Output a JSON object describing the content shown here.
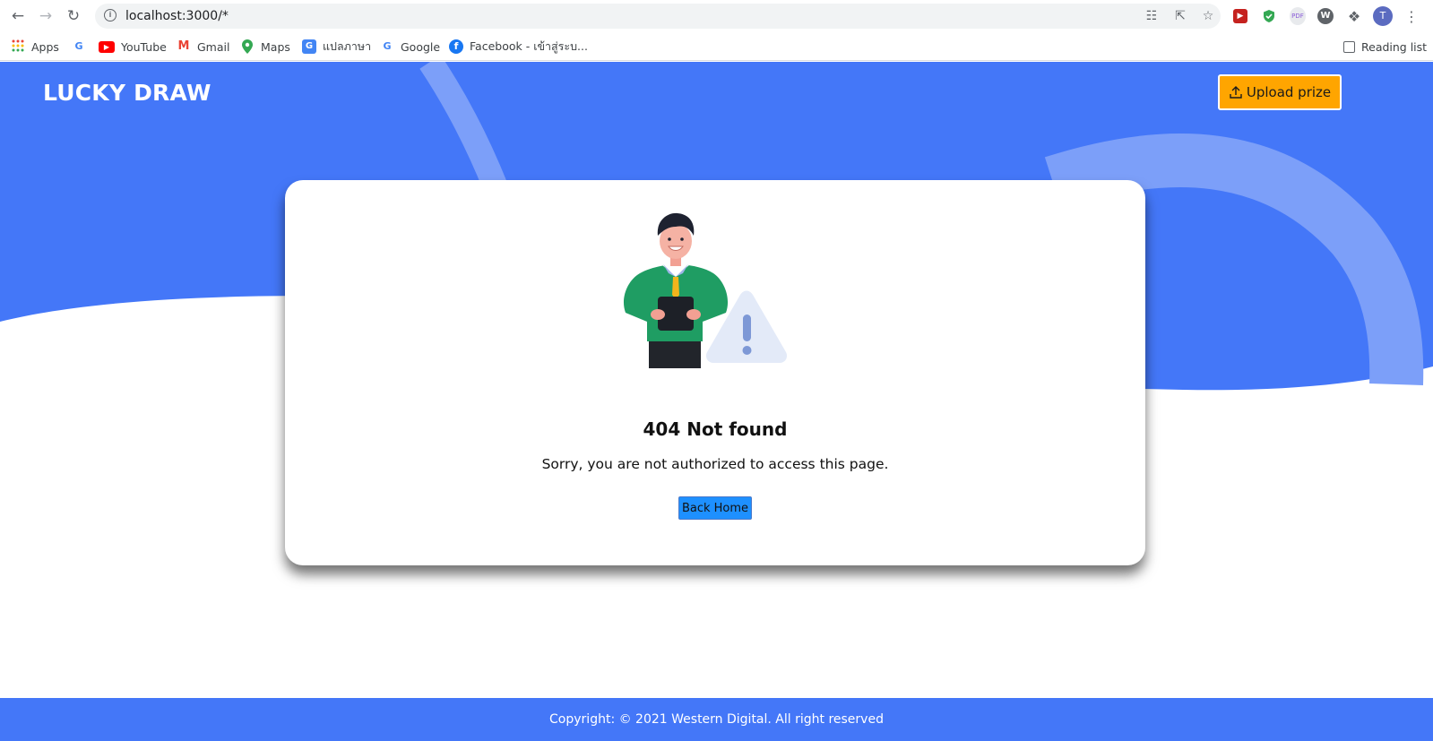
{
  "browser": {
    "url": "localhost:3000/*",
    "reading_list_label": "Reading list",
    "profile_initial": "T",
    "bookmarks": [
      {
        "label": "Apps",
        "icon": "apps-grid-icon"
      },
      {
        "label": "",
        "icon": "google-icon"
      },
      {
        "label": "YouTube",
        "icon": "youtube-icon"
      },
      {
        "label": "Gmail",
        "icon": "gmail-icon"
      },
      {
        "label": "Maps",
        "icon": "maps-pin-icon"
      },
      {
        "label": "แปลภาษา",
        "icon": "translate-icon"
      },
      {
        "label": "Google",
        "icon": "google-icon"
      },
      {
        "label": "Facebook - เข้าสู่ระบ...",
        "icon": "facebook-icon"
      }
    ]
  },
  "header": {
    "brand": "LUCKY DRAW",
    "upload_label": "Upload prize"
  },
  "card": {
    "title": "404 Not found",
    "message": "Sorry, you are not authorized to access this page.",
    "back_label": "Back Home"
  },
  "footer": {
    "copyright": "Copyright: © 2021 Western Digital. All right reserved"
  },
  "colors": {
    "hero_blue": "#4477f8",
    "hero_accent": "#7c9ff9",
    "upload_orange": "#ffa500",
    "back_button_blue": "#1e90ff"
  }
}
